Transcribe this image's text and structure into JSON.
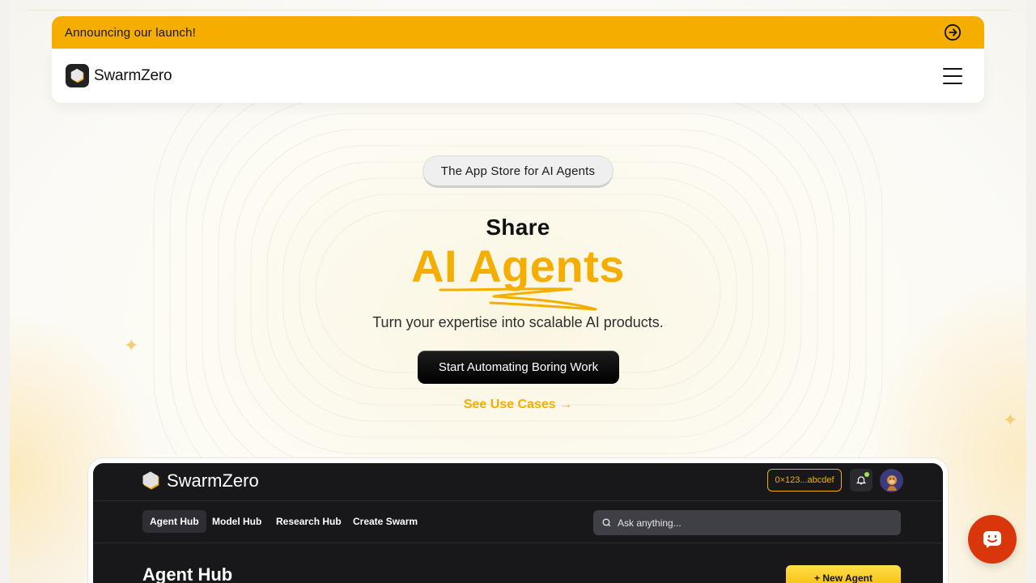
{
  "banner": {
    "text": "Announcing our launch!",
    "icon": "arrow-circle-right-icon"
  },
  "navbar": {
    "brand_name": "SwarmZero",
    "menu_icon": "hamburger-menu-icon"
  },
  "hero": {
    "pill": "The App Store for AI Agents",
    "heading_line1": "Share",
    "heading_line2": "AI Agents",
    "subtitle": "Turn your expertise into scalable AI products.",
    "cta": "Start Automating Boring Work",
    "secondary_link": "See Use Cases →"
  },
  "preview": {
    "brand_name": "SwarmZero",
    "wallet": "0×123...abcdef",
    "tabs": [
      "Agent Hub",
      "Model Hub",
      "Research Hub",
      "Create Swarm"
    ],
    "search_placeholder": "Ask anything...",
    "page_title": "Agent Hub",
    "new_agent_button": "+ New Agent"
  },
  "chat": {
    "icon": "chat-face-icon"
  },
  "colors": {
    "accent": "#f5ae00",
    "chat": "#d9360b",
    "dark": "#18181b"
  }
}
